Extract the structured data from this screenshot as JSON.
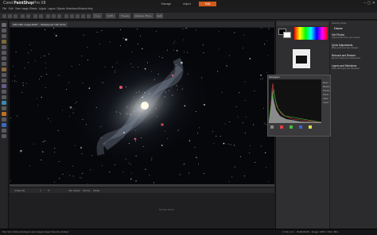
{
  "app": {
    "title_prefix": "Corel",
    "title_main": "PaintShop",
    "title_suffix": "Pro X8"
  },
  "window_controls": "–  ▢  ✕",
  "menu": [
    "File",
    "Edit",
    "View",
    "Image",
    "Effects",
    "Adjust",
    "Layers",
    "Objects",
    "Selections",
    "Window",
    "Help"
  ],
  "workspace_tabs": [
    "Manage",
    "Adjust",
    "Edit"
  ],
  "toolbar": {
    "crop_label": "Crop",
    "zoom_value": "101%",
    "preset_label": "Presets",
    "mode_label": "Enhance Photo",
    "ratio_label": "Edit"
  },
  "document": {
    "tab_label": "M33 CBG ImageLRGB* – Multilayered TIFF (8 bit)"
  },
  "learning": {
    "header": "Learning Center",
    "title": "Home",
    "items": [
      {
        "title": "Get Photos",
        "sub": "Import photos from your camera"
      },
      {
        "title": "Quick Adjustments",
        "sub": "Make quick one-step changes"
      },
      {
        "title": "Retouch and Restore",
        "sub": "Remove flaws and imperfections"
      },
      {
        "title": "Layers and Selections",
        "sub": "Work with layers and selections"
      }
    ]
  },
  "histogram": {
    "title": "Histogram",
    "stats": [
      "Mean:",
      "Median:",
      "Std dev:",
      "Pixels:",
      "Value:",
      "Count:"
    ]
  },
  "organizer": {
    "tabs": [
      "4 Note (0)",
      "□",
      "✎",
      "Info Viewer",
      "Sort by",
      "Folder"
    ],
    "empty_text": "No files found"
  },
  "status": {
    "left": "Pan Tool: Click and drag to pan images larger than the window",
    "right": "x=1(1) y=1 ... 8192x5248 – Image: 1056 x 790 x 8bit ..."
  },
  "colors": {
    "accent": "#d25a1c",
    "canvas": "#06070b"
  }
}
